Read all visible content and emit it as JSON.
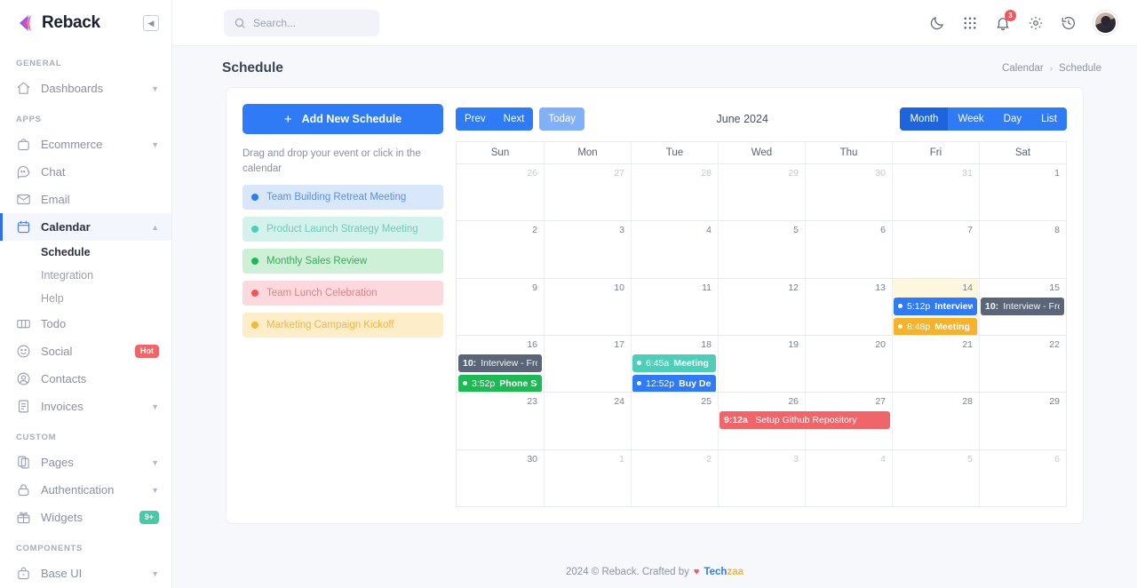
{
  "brand": {
    "name": "Reback",
    "collapse_icon": "chevron-left-icon"
  },
  "sidebar": {
    "sections": [
      {
        "label": "GENERAL",
        "items": [
          {
            "label": "Dashboards",
            "icon": "home-icon",
            "chevron": true
          }
        ]
      },
      {
        "label": "APPS",
        "items": [
          {
            "label": "Ecommerce",
            "icon": "bag-icon",
            "chevron": true
          },
          {
            "label": "Chat",
            "icon": "chat-icon"
          },
          {
            "label": "Email",
            "icon": "mail-icon"
          },
          {
            "label": "Calendar",
            "icon": "calendar-icon",
            "chevron": true,
            "active": true,
            "expanded": true,
            "children": [
              {
                "label": "Schedule",
                "active": true
              },
              {
                "label": "Integration"
              },
              {
                "label": "Help"
              }
            ]
          },
          {
            "label": "Todo",
            "icon": "todo-icon"
          },
          {
            "label": "Social",
            "icon": "smiley-icon",
            "badge": "Hot",
            "badge_kind": "hot"
          },
          {
            "label": "Contacts",
            "icon": "user-circle-icon"
          },
          {
            "label": "Invoices",
            "icon": "invoice-icon",
            "chevron": true
          }
        ]
      },
      {
        "label": "CUSTOM",
        "items": [
          {
            "label": "Pages",
            "icon": "pages-icon",
            "chevron": true
          },
          {
            "label": "Authentication",
            "icon": "lock-icon",
            "chevron": true
          },
          {
            "label": "Widgets",
            "icon": "gift-icon",
            "badge": "9+",
            "badge_kind": "nine"
          }
        ]
      },
      {
        "label": "COMPONENTS",
        "items": [
          {
            "label": "Base UI",
            "icon": "briefcase-icon",
            "chevron": true
          }
        ]
      }
    ]
  },
  "topbar": {
    "search": {
      "placeholder": "Search...",
      "value": "",
      "icon": "search-icon"
    },
    "icons": [
      {
        "name": "moon-icon"
      },
      {
        "name": "grid-apps-icon"
      },
      {
        "name": "bell-icon",
        "badge": "3"
      },
      {
        "name": "gear-icon"
      },
      {
        "name": "history-icon"
      }
    ],
    "avatar": {
      "name": "avatar"
    }
  },
  "page": {
    "title": "Schedule",
    "breadcrumb": {
      "parent": "Calendar",
      "separator": "›",
      "current": "Schedule"
    }
  },
  "left_panel": {
    "add_button": {
      "label": "Add New Schedule",
      "icon": "plus-icon"
    },
    "hint": "Drag and drop your event or click in the calendar",
    "events": [
      {
        "label": "Team Building Retreat Meeting",
        "bg": "#d9e7fb",
        "fg": "#5b8fe3",
        "dot": "#2f7bf6"
      },
      {
        "label": "Product Launch Strategy Meeting",
        "bg": "#d3f2ec",
        "fg": "#6fc9bc",
        "dot": "#4ecdb8"
      },
      {
        "label": "Monthly Sales Review",
        "bg": "#cdf0d6",
        "fg": "#3aa85a",
        "dot": "#1db954"
      },
      {
        "label": "Team Lunch Celebration",
        "bg": "#fbd9dc",
        "fg": "#ec7c86",
        "dot": "#f0565c"
      },
      {
        "label": "Marketing Campaign Kickoff",
        "bg": "#fdeec9",
        "fg": "#f0b54a",
        "dot": "#f5b833"
      }
    ]
  },
  "calendar": {
    "toolbar": {
      "prev": "Prev",
      "next": "Next",
      "today": "Today",
      "title": "June 2024",
      "views": [
        "Month",
        "Week",
        "Day",
        "List"
      ],
      "active_view": "Month"
    },
    "day_headers": [
      "Sun",
      "Mon",
      "Tue",
      "Wed",
      "Thu",
      "Fri",
      "Sat"
    ],
    "weeks": [
      [
        {
          "num": "26",
          "other": true
        },
        {
          "num": "27",
          "other": true
        },
        {
          "num": "28",
          "other": true
        },
        {
          "num": "29",
          "other": true
        },
        {
          "num": "30",
          "other": true
        },
        {
          "num": "31",
          "other": true
        },
        {
          "num": "1"
        }
      ],
      [
        {
          "num": "2"
        },
        {
          "num": "3"
        },
        {
          "num": "4"
        },
        {
          "num": "5"
        },
        {
          "num": "6"
        },
        {
          "num": "7"
        },
        {
          "num": "8"
        }
      ],
      [
        {
          "num": "9"
        },
        {
          "num": "10"
        },
        {
          "num": "11"
        },
        {
          "num": "12"
        },
        {
          "num": "13"
        },
        {
          "num": "14",
          "today": true
        },
        {
          "num": "15"
        }
      ],
      [
        {
          "num": "16"
        },
        {
          "num": "17"
        },
        {
          "num": "18"
        },
        {
          "num": "19"
        },
        {
          "num": "20"
        },
        {
          "num": "21"
        },
        {
          "num": "22"
        }
      ],
      [
        {
          "num": "23"
        },
        {
          "num": "24"
        },
        {
          "num": "25"
        },
        {
          "num": "26"
        },
        {
          "num": "27"
        },
        {
          "num": "28"
        },
        {
          "num": "29"
        }
      ],
      [
        {
          "num": "30"
        },
        {
          "num": "1",
          "other": true
        },
        {
          "num": "2",
          "other": true
        },
        {
          "num": "3",
          "other": true
        },
        {
          "num": "4",
          "other": true
        },
        {
          "num": "5",
          "other": true
        },
        {
          "num": "6",
          "other": true
        }
      ]
    ],
    "events": [
      {
        "week": 2,
        "col": 5,
        "span": 1,
        "row": 0,
        "time": "5:12p",
        "title": "Interview -",
        "bg": "#2f7bf6",
        "dot": true
      },
      {
        "week": 2,
        "col": 5,
        "span": 1,
        "row": 1,
        "time": "8:48p",
        "title": "Meeting w",
        "bg": "#f5b22c",
        "dot": true
      },
      {
        "week": 2,
        "col": 6,
        "span": 1,
        "row": 0,
        "time": "10:",
        "title": "Interview - Fron",
        "bg": "#5a6578",
        "block": true
      },
      {
        "week": 3,
        "col": 0,
        "span": 1,
        "row": 0,
        "time": "10:",
        "title": "Interview - Fron",
        "bg": "#5a6578",
        "block": true
      },
      {
        "week": 3,
        "col": 0,
        "span": 1,
        "row": 1,
        "time": "3:52p",
        "title": "Phone Scre",
        "bg": "#1db954",
        "dot": true
      },
      {
        "week": 3,
        "col": 2,
        "span": 1,
        "row": 0,
        "time": "6:45a",
        "title": "Meeting w",
        "bg": "#4ecdb8",
        "dot": true
      },
      {
        "week": 3,
        "col": 2,
        "span": 1,
        "row": 1,
        "time": "12:52p",
        "title": "Buy Desig",
        "bg": "#2f7bf6",
        "dot": true
      },
      {
        "week": 4,
        "col": 3,
        "span": 2,
        "row": 0,
        "time": "9:12a",
        "title": "Setup Github Repository",
        "bg": "#f0656a",
        "wide": true
      }
    ]
  },
  "footer": {
    "text": "2024 © Reback. Crafted by",
    "heart": "♥",
    "brand_1": "Tech",
    "brand_2": "zaa"
  }
}
